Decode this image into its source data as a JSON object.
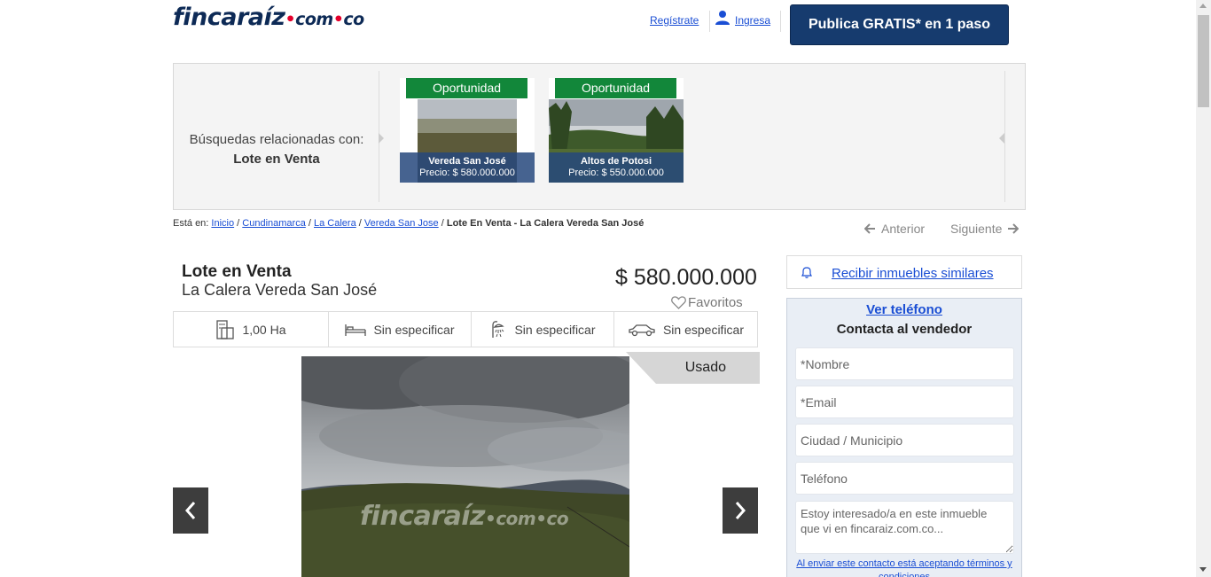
{
  "header": {
    "logo_main": "fincaraíz",
    "logo_com": "com",
    "logo_co": "co",
    "register_label": "Regístrate",
    "login_label": "Ingresa",
    "publish_label": "Publica GRATIS* en 1 paso"
  },
  "related": {
    "label_line1": "Búsquedas relacionadas con:",
    "label_line2": "Lote en Venta",
    "cards": [
      {
        "badge": "Oportunidad",
        "title": "Vereda San José",
        "price": "Precio: $ 580.000.000"
      },
      {
        "badge": "Oportunidad",
        "title": "Altos de Potosi",
        "price": "Precio: $ 550.000.000"
      }
    ]
  },
  "breadcrumb": {
    "prefix": "Está en:",
    "items": [
      "Inicio",
      "Cundinamarca",
      "La Calera",
      "Vereda San Jose"
    ],
    "current": "Lote En Venta - La Calera Vereda San José"
  },
  "pager": {
    "previous": "Anterior",
    "next": "Siguiente"
  },
  "listing": {
    "title": "Lote en Venta",
    "subtitle": "La Calera Vereda San José",
    "price": "$ 580.000.000",
    "favorites_label": "Favoritos",
    "condition": "Usado",
    "features": [
      {
        "icon": "area-icon",
        "value": "1,00 Ha"
      },
      {
        "icon": "bed-icon",
        "value": "Sin especificar"
      },
      {
        "icon": "shower-icon",
        "value": "Sin especificar"
      },
      {
        "icon": "car-icon",
        "value": "Sin especificar"
      }
    ],
    "watermark_main": "fincaraíz",
    "watermark_com": "com",
    "watermark_co": "co"
  },
  "sidebar": {
    "similar_label": "Recibir inmuebles similares",
    "phone_label": "Ver teléfono",
    "contact_heading": "Contacta al vendedor",
    "name_placeholder": "*Nombre",
    "email_placeholder": "*Email",
    "city_placeholder": "Ciudad / Municipio",
    "phone_placeholder": "Teléfono",
    "message_placeholder": "Estoy interesado/a en este inmueble que vi en fincaraiz.com.co...",
    "terms_text": "Al enviar este contacto está aceptando términos y condiciones"
  },
  "colors": {
    "brand_navy": "#163b6e",
    "accent_red": "#e4002b",
    "badge_green": "#12873a",
    "link_blue": "#1a4ed4"
  }
}
